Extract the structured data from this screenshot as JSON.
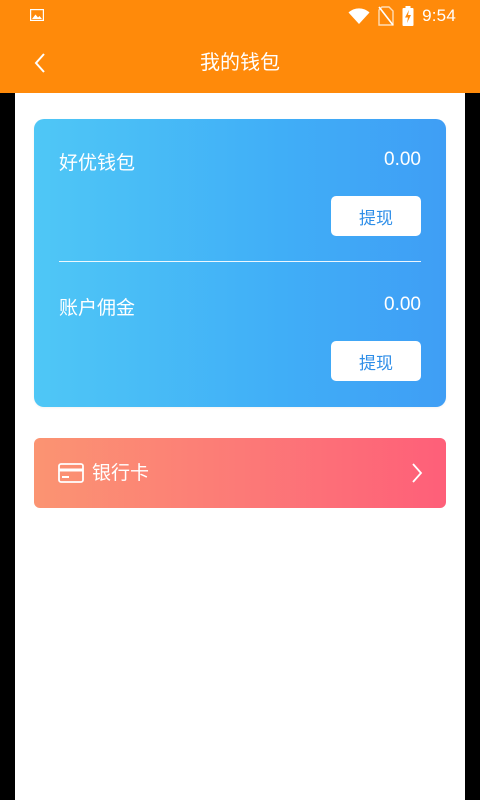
{
  "status_bar": {
    "time": "9:54",
    "icons": [
      "image-icon",
      "wifi-icon",
      "no-sim-icon",
      "battery-charging-icon"
    ]
  },
  "header": {
    "title": "我的钱包",
    "back_icon": "chevron-left-icon"
  },
  "wallet": {
    "haoyou": {
      "label": "好优钱包",
      "amount": "0.00",
      "button_label": "提现"
    },
    "commission": {
      "label": "账户佣金",
      "amount": "0.00",
      "button_label": "提现"
    }
  },
  "bank_card": {
    "label": "银行卡",
    "icon": "credit-card-icon",
    "chevron_icon": "chevron-right-icon"
  },
  "colors": {
    "header_bg": "#ff8a0a",
    "wallet_gradient_start": "#4fc7f6",
    "wallet_gradient_end": "#3f9ef5",
    "bank_gradient_start": "#fb9472",
    "bank_gradient_end": "#fe5f79",
    "button_text": "#2e8ee8"
  }
}
